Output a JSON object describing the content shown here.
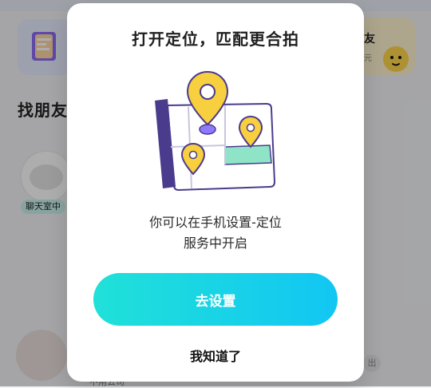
{
  "background": {
    "section_title": "找朋友",
    "card_right_title": "友",
    "card_right_sub": "元",
    "chip_label": "聊天室中",
    "bottom_text": "不用公司",
    "right_chip": "出"
  },
  "dialog": {
    "title": "打开定位，匹配更合拍",
    "description_line1": "你可以在手机设置-定位",
    "description_line2": "服务中开启",
    "primary_button_label": "去设置",
    "secondary_button_label": "我知道了"
  },
  "colors": {
    "primary_gradient_start": "#20e1d8",
    "primary_gradient_end": "#12c6f3",
    "pin_yellow": "#f7cf3f",
    "map_green": "#8fe3c7",
    "map_purple": "#4b3b8c",
    "pin_purple": "#8f79ff"
  }
}
